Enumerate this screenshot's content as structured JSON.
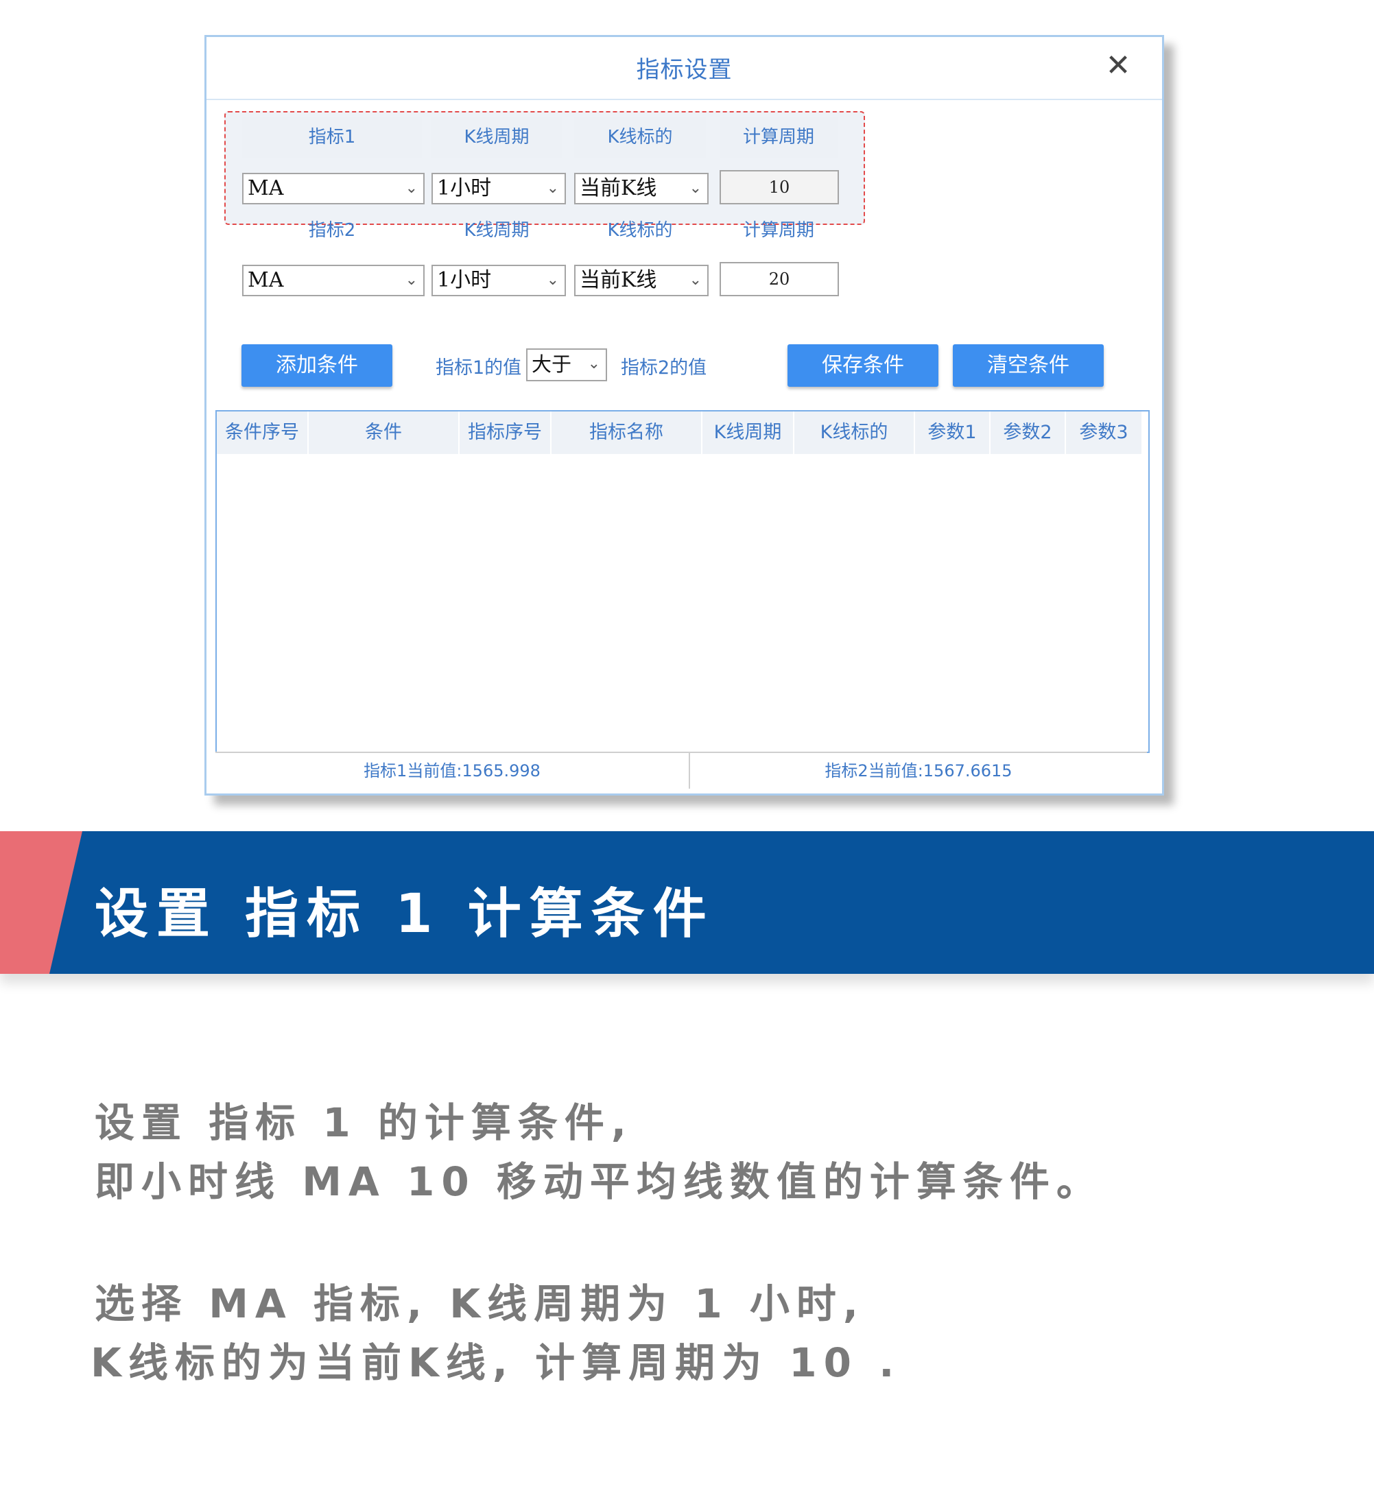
{
  "dialog": {
    "title": "指标设置",
    "close": "✕",
    "row1": {
      "indicator_label": "指标1",
      "kline_period_label": "K线周期",
      "kline_target_label": "K线标的",
      "calc_period_label": "计算周期",
      "indicator_value": "MA",
      "kline_period_value": "1小时",
      "kline_target_value": "当前K线",
      "calc_period_value": "10"
    },
    "row2": {
      "indicator_label": "指标2",
      "kline_period_label": "K线周期",
      "kline_target_label": "K线标的",
      "calc_period_label": "计算周期",
      "indicator_value": "MA",
      "kline_period_value": "1小时",
      "kline_target_value": "当前K线",
      "calc_period_value": "20"
    },
    "add_button": "添加条件",
    "compare_left": "指标1的值",
    "compare_value": "大于",
    "compare_right": "指标2的值",
    "save_button": "保存条件",
    "clear_button": "清空条件",
    "table_headers": [
      "条件序号",
      "条件",
      "指标序号",
      "指标名称",
      "K线周期",
      "K线标的",
      "参数1",
      "参数2",
      "参数3"
    ],
    "status_left": "指标1当前值:1565.998",
    "status_right": "指标2当前值:1567.6615"
  },
  "banner": {
    "title": "设置 指标 1 计算条件",
    "colors": {
      "accent": "#e96d74",
      "main": "#07539b"
    }
  },
  "description": {
    "line1": "设置 指标 1 的计算条件,",
    "line2": "即小时线 MA 10 移动平均线数值的计算条件。",
    "line3": "选择 MA 指标, K线周期为 1 小时,",
    "line4": "K线标的为当前K线, 计算周期为 10 ."
  }
}
